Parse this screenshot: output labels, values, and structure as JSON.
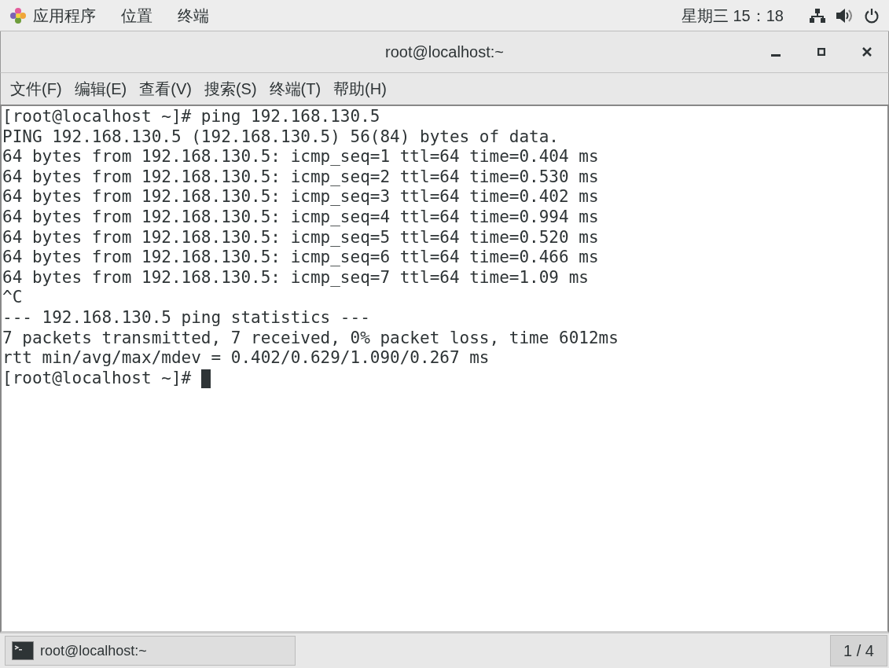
{
  "top_bar": {
    "menus": [
      "应用程序",
      "位置",
      "终端"
    ],
    "clock": "星期三 15：18"
  },
  "window": {
    "title": "root@localhost:~"
  },
  "menu_bar": [
    "文件(F)",
    "编辑(E)",
    "查看(V)",
    "搜索(S)",
    "终端(T)",
    "帮助(H)"
  ],
  "terminal": {
    "lines": [
      "[root@localhost ~]# ping 192.168.130.5",
      "PING 192.168.130.5 (192.168.130.5) 56(84) bytes of data.",
      "64 bytes from 192.168.130.5: icmp_seq=1 ttl=64 time=0.404 ms",
      "64 bytes from 192.168.130.5: icmp_seq=2 ttl=64 time=0.530 ms",
      "64 bytes from 192.168.130.5: icmp_seq=3 ttl=64 time=0.402 ms",
      "64 bytes from 192.168.130.5: icmp_seq=4 ttl=64 time=0.994 ms",
      "64 bytes from 192.168.130.5: icmp_seq=5 ttl=64 time=0.520 ms",
      "64 bytes from 192.168.130.5: icmp_seq=6 ttl=64 time=0.466 ms",
      "64 bytes from 192.168.130.5: icmp_seq=7 ttl=64 time=1.09 ms",
      "^C",
      "--- 192.168.130.5 ping statistics ---",
      "7 packets transmitted, 7 received, 0% packet loss, time 6012ms",
      "rtt min/avg/max/mdev = 0.402/0.629/1.090/0.267 ms",
      "[root@localhost ~]# "
    ]
  },
  "taskbar": {
    "task": "root@localhost:~",
    "workspace": "1 / 4"
  }
}
